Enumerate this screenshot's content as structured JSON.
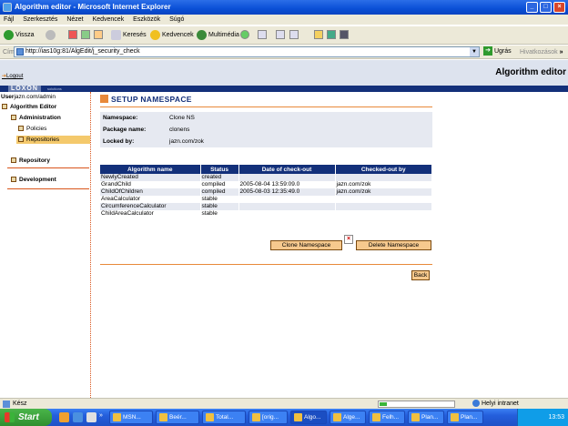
{
  "window": {
    "title": "Algorithm editor - Microsoft Internet Explorer"
  },
  "menu": [
    "Fájl",
    "Szerkesztés",
    "Nézet",
    "Kedvencek",
    "Eszközök",
    "Súgó"
  ],
  "toolbar": {
    "back": "Vissza",
    "search": "Keresés",
    "favorites": "Kedvencek",
    "media": "Multimédia"
  },
  "address": {
    "label": "Cím",
    "url": "http://ias10g:81/AlgEdit/j_security_check",
    "go": "Ugrás",
    "links": "Hivatkozások",
    "more": "»"
  },
  "header": {
    "logout": "Logout",
    "title": "Algorithm editor",
    "logo": "LOXON",
    "logo_sub": "solutions"
  },
  "sidebar": {
    "user_label": "User",
    "user": "jazn.com/admin",
    "items": [
      {
        "label": "Algorithm Editor"
      },
      {
        "label": "Administration"
      },
      {
        "label": "Policies"
      },
      {
        "label": "Repositories"
      },
      {
        "label": "Repository"
      },
      {
        "label": "Development"
      }
    ]
  },
  "main": {
    "heading": "SETUP NAMESPACE",
    "info": [
      {
        "key": "Namespace:",
        "value": "Clone NS"
      },
      {
        "key": "Package name:",
        "value": "clonens"
      },
      {
        "key": "Locked by:",
        "value": "jazn.com/zok"
      }
    ],
    "table": {
      "columns": [
        "Algorithm name",
        "Status",
        "Date of check-out",
        "Checked-out by"
      ],
      "rows": [
        [
          "NewlyCreated",
          "created",
          "",
          ""
        ],
        [
          "GrandChild",
          "compiled",
          "2005-08-04 13:59:09.0",
          "jazn.com/zok"
        ],
        [
          "ChildOfChildren",
          "compiled",
          "2005-08-03 12:35:49.0",
          "jazn.com/zok"
        ],
        [
          "AreaCalculator",
          "stable",
          "",
          ""
        ],
        [
          "CircumferenceCalculator",
          "stable",
          "",
          ""
        ],
        [
          "ChildAreaCalculator",
          "stable",
          "",
          ""
        ]
      ]
    },
    "buttons": {
      "clone": "Clone Namespace",
      "delete": "Delete Namespace",
      "back": "Back"
    }
  },
  "status": {
    "text": "Kész",
    "zone": "Helyi intranet",
    "progress": 0.1
  },
  "taskbar": {
    "start": "Start",
    "tasks": [
      "MSN...",
      "Beér...",
      "Total...",
      "[orig...",
      "Algo...",
      "Alge...",
      "Felh...",
      "Plan...",
      "Plan..."
    ],
    "clock": "13:53"
  }
}
